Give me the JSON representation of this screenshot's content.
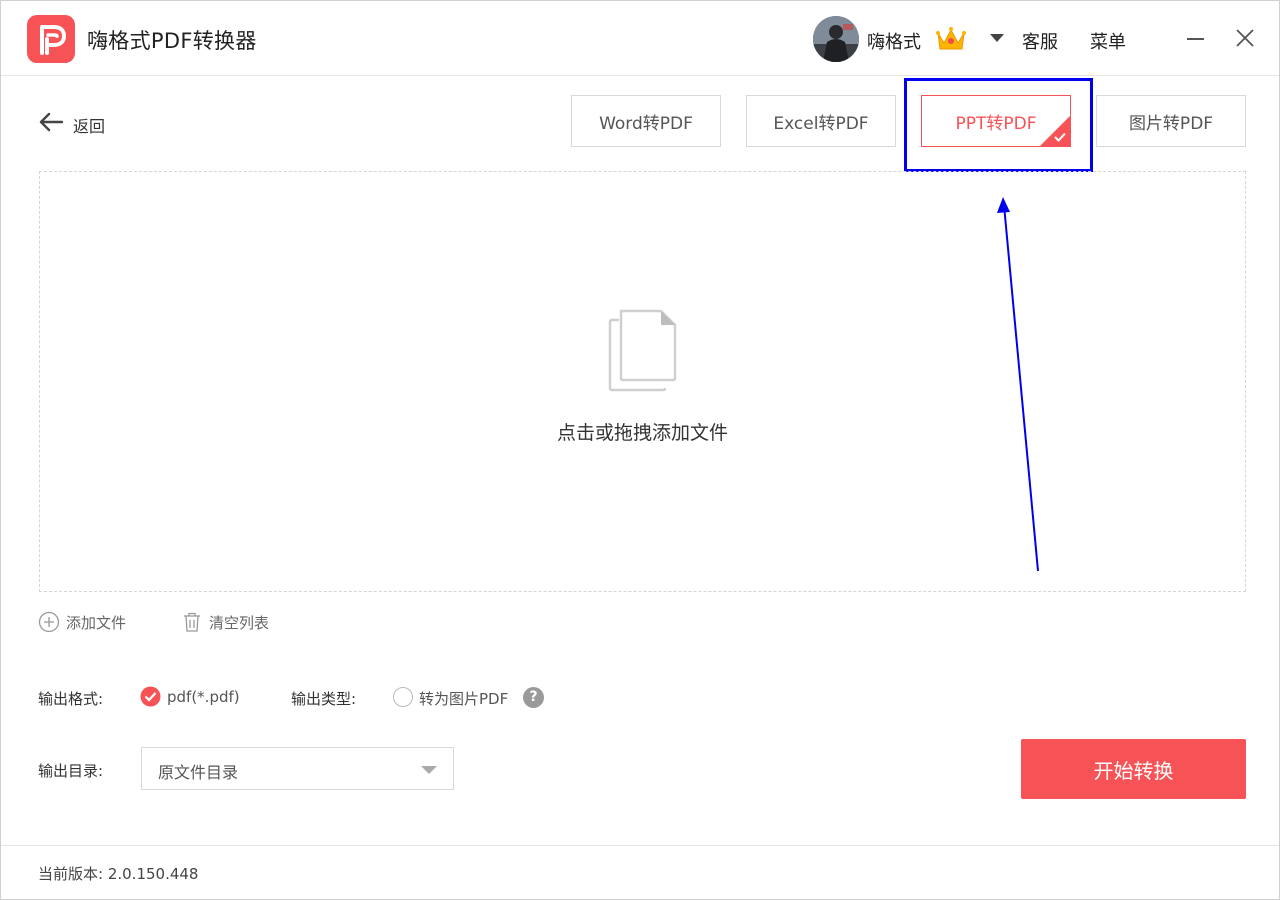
{
  "app": {
    "title": "嗨格式PDF转换器"
  },
  "header": {
    "user_name": "嗨格式",
    "service_label": "客服",
    "menu_label": "菜单"
  },
  "toolbar": {
    "back_label": "返回",
    "tabs": [
      {
        "label": "Word转PDF",
        "active": false
      },
      {
        "label": "Excel转PDF",
        "active": false
      },
      {
        "label": "PPT转PDF",
        "active": true
      },
      {
        "label": "图片转PDF",
        "active": false
      }
    ]
  },
  "dropzone": {
    "hint": "点击或拖拽添加文件"
  },
  "list_actions": {
    "add_file": "添加文件",
    "clear_list": "清空列表"
  },
  "output": {
    "format_label": "输出格式:",
    "format_value": "pdf(*.pdf)",
    "format_checked": true,
    "type_label": "输出类型:",
    "type_option": "转为图片PDF",
    "type_checked": false,
    "dir_label": "输出目录:",
    "dir_value": "原文件目录"
  },
  "start_button": "开始转换",
  "footer": {
    "version": "当前版本: 2.0.150.448"
  },
  "colors": {
    "accent": "#f75357",
    "annotation": "#0000ee"
  }
}
